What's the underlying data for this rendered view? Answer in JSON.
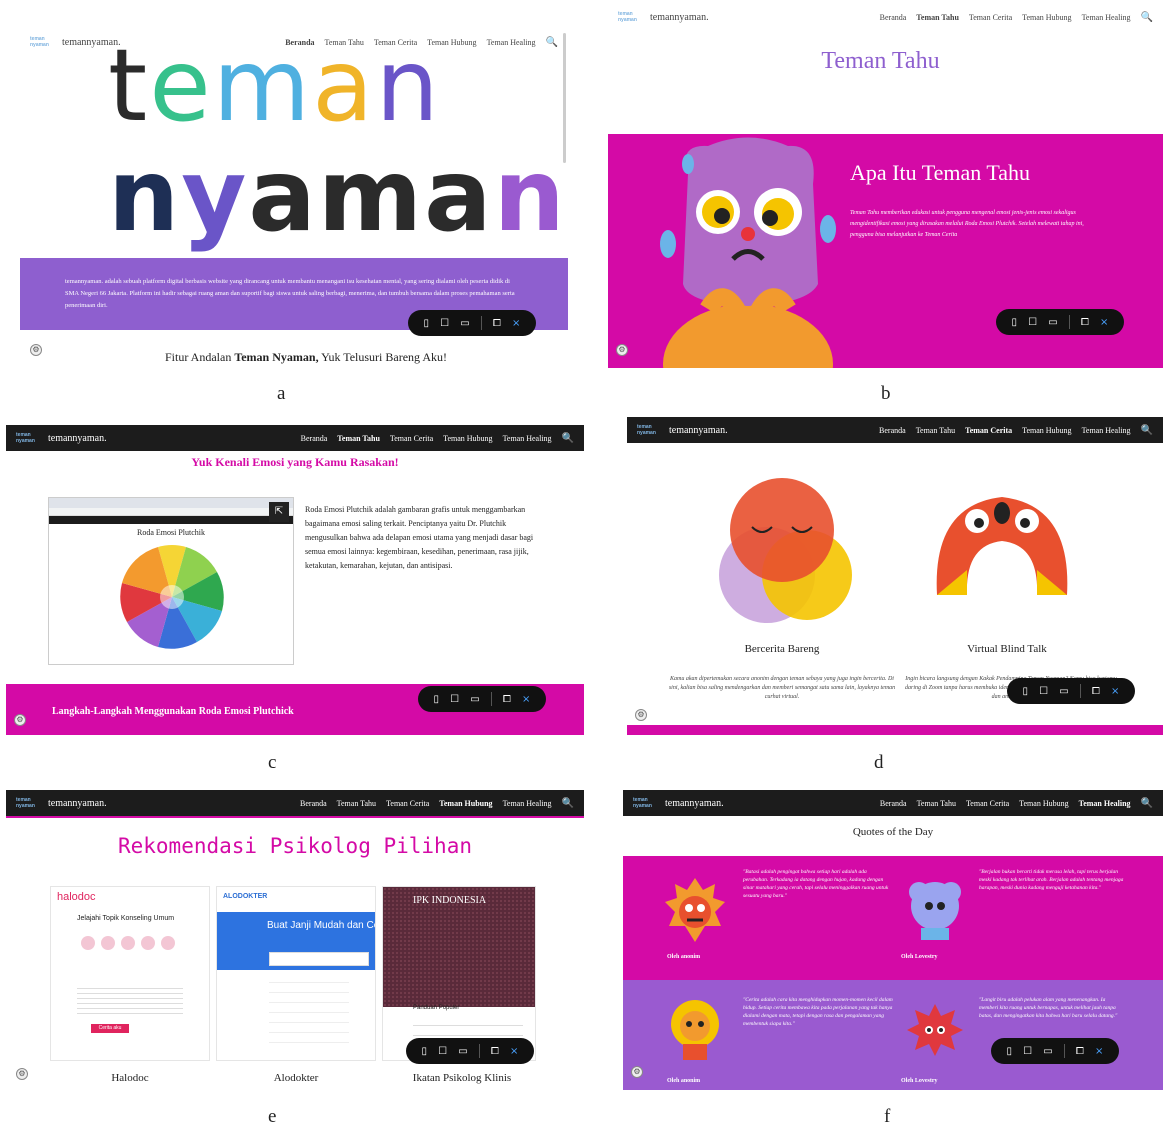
{
  "captions": {
    "a": "a",
    "b": "b",
    "c": "c",
    "d": "d",
    "e": "e",
    "f": "f"
  },
  "nav": {
    "brand": "temannyaman.",
    "logo": "teman nyaman",
    "items": [
      "Beranda",
      "Teman Tahu",
      "Teman Cerita",
      "Teman Hubung",
      "Teman Healing"
    ]
  },
  "toolbar": {
    "icons": [
      "phone-icon",
      "tablet-icon",
      "laptop-icon",
      "book-icon",
      "close-icon"
    ],
    "close": "×"
  },
  "panel_a": {
    "hero_line1": "teman",
    "hero_line2": "nyaman.",
    "intro": "temannyaman. adalah sebuah platform digital berbasis website yang dirancang untuk membantu menangani isu kesehatan mental, yang sering dialami oleh peserta didik di SMA Negeri 66 Jakarta. Platform ini hadir sebagai ruang aman dan suportif bagi siswa untuk saling berbagi, menerima, dan tumbuh bersama dalam proses pemahaman serta penerimaan diri.",
    "features_prefix": "Fitur Andalan ",
    "features_bold": "Teman Nyaman,",
    "features_suffix": " Yuk Telusuri Bareng Aku!",
    "colors": {
      "purple": "#8e5fcf",
      "t": "#2b2b2b",
      "e": "#37c18c",
      "m": "#4fb0e0",
      "a": "#f0b429",
      "n": "#6a55c8"
    }
  },
  "panel_b": {
    "title": "Teman Tahu",
    "heading": "Apa Itu Teman Tahu",
    "body": "Teman Tahu memberikan edukasi untuk pengguna mengenal emosi jenis-jenis emosi sekaligus mengidentifikasi emosi yang dirasakan melalui Roda Emosi Plutchik. Setelah melewati tahap ini, pengguna bisa melanjutkan ke Teman Cerita",
    "colors": {
      "magenta": "#d40aa6"
    }
  },
  "panel_c": {
    "heading": "Yuk Kenali Emosi yang Kamu Rasakan!",
    "wheel_title": "Roda Emosi Plutchik",
    "body": "Roda Emosi Plutchik adalah gambaran grafis untuk menggambarkan bagaimana emosi saling terkait. Penciptanya yaitu Dr. Plutchik mengusulkan bahwa ada delapan emosi utama yang menjadi dasar bagi semua emosi lainnya: kegembiraan, kesedihan, penerimaan, rasa jijik, ketakutan, kemarahan, kejutan, dan antisipasi.",
    "steps": "Langkah-Langkah Menggunakan Roda Emosi Plutchick",
    "colors": {
      "magenta": "#d40aa6"
    }
  },
  "panel_d": {
    "cards": [
      {
        "title": "Bercerita Bareng",
        "desc": "Kamu akan dipertemukan secara anonim dengan teman sebaya yang juga ingin bercerita. Di sini, kalian bisa saling mendengarkan dan memberi semangat satu sama lain, layaknya teman curhat virtual."
      },
      {
        "title": "Virtual Blind Talk",
        "desc": "Ingin bicara langsung dengan Kakak Pendamping Teman Nyaman? Kamu bisa bertemu daring di Zoom tanpa harus membuka identitasmu. Semua sesi dilakukan secara hangat dan aman untuk"
      }
    ]
  },
  "panel_e": {
    "heading": "Rekomendasi Psikolog Pilihan",
    "cards": [
      {
        "title": "Halodoc",
        "logo": "halodoc",
        "sub": "Jelajahi Topik Konseling Umum",
        "btn": "Cerita aku"
      },
      {
        "title": "Alodokter",
        "logo": "ALODOKTER",
        "sub": "Buat Janji Mudah dan Cepat"
      },
      {
        "title": "Ikatan Psikolog Klinis",
        "logo": "IPK INDONESIA",
        "sub": "Panduan Populer"
      }
    ],
    "colors": {
      "pink": "#d40aa6"
    }
  },
  "panel_f": {
    "title": "Quotes of the Day",
    "quotes": [
      {
        "text": "\"Batasi adalah pengingat bahwa setiap hari adalah ada perubahan. Terkadang ia datang dengan hujan, kadang dengan sinar matahari yang cerah, tapi selalu meninggalkan ruang untuk sesuatu yang baru.\"",
        "by": "Oleh anonim"
      },
      {
        "text": "\"Berjalan bukan berarti tidak merasa lelah, tapi terus berjalan meski kadang tak terlihat arah. Berjalan adalah tentang menjaga harapan, meski dunia kadang menguji ketahanan kita.\"",
        "by": "Oleh Lovestry"
      },
      {
        "text": "\"Cerita adalah cara kita menghidupkan momen-momen kecil dalam hidup. Setiap cerita membawa kita pada perjalanan yang tak hanya dialami dengan mata, tetapi dengan rasa dan pengalaman yang membentuk siapa kita.\"",
        "by": "Oleh anonim"
      },
      {
        "text": "\"Langit biru adalah pelukan alam yang menenangkan. Ia memberi kita ruang untuk bernapas, untuk melihat jauh tanpa batas, dan mengingatkan kita bahwa hari baru selalu datang.\"",
        "by": "Oleh Lovestry"
      }
    ],
    "colors": {
      "magenta": "#d40aa6",
      "purple": "#9a5ad0"
    }
  }
}
